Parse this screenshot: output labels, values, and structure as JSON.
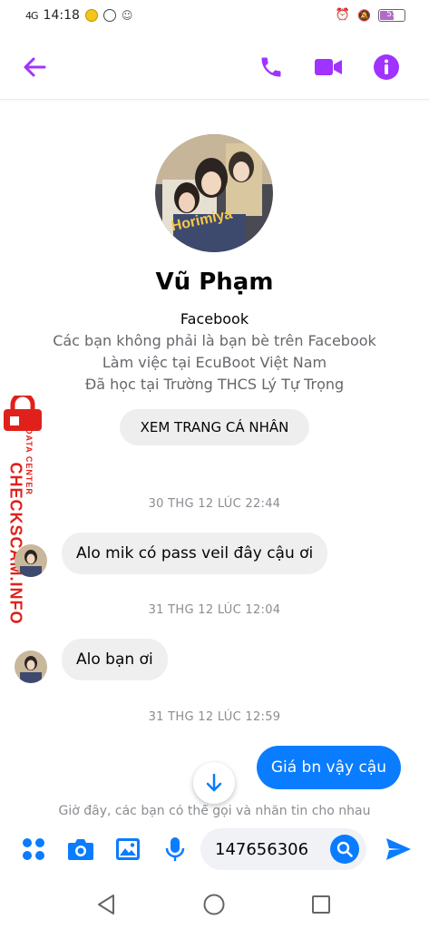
{
  "status_bar": {
    "signal": "4G",
    "time": "14:18",
    "battery_level": "55"
  },
  "header": {
    "back_icon": "arrow-left-icon",
    "call_icon": "phone-icon",
    "video_icon": "video-camera-icon",
    "info_icon": "info-icon",
    "accent": "#a033ff"
  },
  "profile": {
    "name": "Vũ Phạm",
    "platform": "Facebook",
    "friend_status": "Các bạn không phải là bạn bè trên Facebook",
    "work": "Làm việc tại EcuBoot Việt Nam",
    "education": "Đã học tại Trường THCS Lý Tự Trọng",
    "view_profile_label": "XEM TRANG CÁ NHÂN"
  },
  "watermark": {
    "brand": "CHECKSCAM.INFO",
    "tagline": "DATA CENTER",
    "color": "#e0211b"
  },
  "messages": {
    "ts1": "30 THG 12 LÚC 22:44",
    "msg1": "Alo mik có pass veil đây cậu ơi",
    "ts2": "31 THG 12 LÚC 12:04",
    "msg2": "Alo bạn ơi",
    "ts3": "31 THG 12 LÚC 12:59",
    "msg3": "Giá bn vậy cậu"
  },
  "hint": "Giờ đây, các bạn có thể gọi và nhắn tin cho nhau",
  "composer": {
    "input_value": "147656306",
    "send_color": "#0a7cff"
  },
  "colors": {
    "incoming_bubble": "#efefef",
    "outgoing_bubble": "#0a7cff"
  }
}
